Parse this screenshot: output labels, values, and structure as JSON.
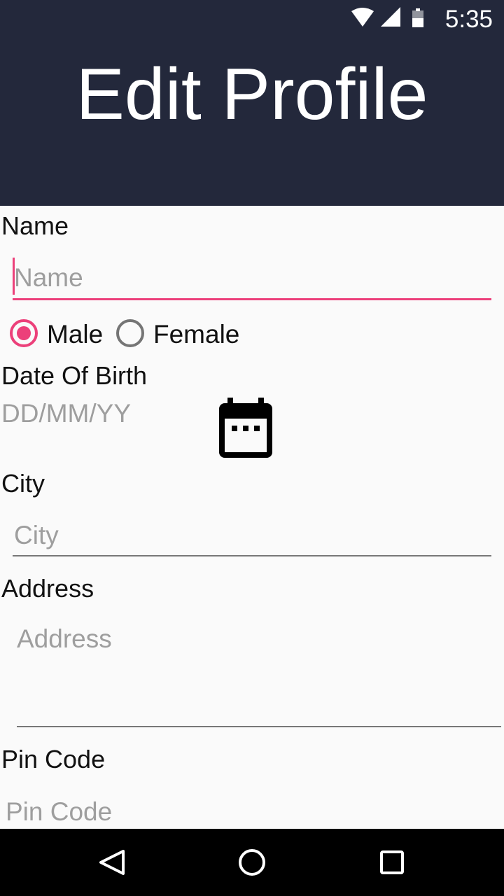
{
  "status_bar": {
    "time": "5:35",
    "icons": [
      "wifi-icon",
      "signal-icon",
      "battery-icon"
    ]
  },
  "header": {
    "title": "Edit Profile",
    "background": "#23283b"
  },
  "form": {
    "name_label": "Name",
    "name_placeholder": "Name",
    "gender_options": [
      "Male",
      "Female"
    ],
    "gender_selected": "Male",
    "dob_label": "Date Of Birth",
    "dob_value": "DD/MM/YY",
    "city_label": "City",
    "city_placeholder": "City",
    "address_label": "Address",
    "address_placeholder": "Address",
    "pin_label": "Pin Code",
    "pin_placeholder": "Pin Code"
  },
  "nav": {
    "icons": [
      "back-icon",
      "home-icon",
      "recents-icon"
    ]
  },
  "colors": {
    "accent": "#ec407a",
    "header": "#23283b",
    "background": "#fafafa"
  }
}
